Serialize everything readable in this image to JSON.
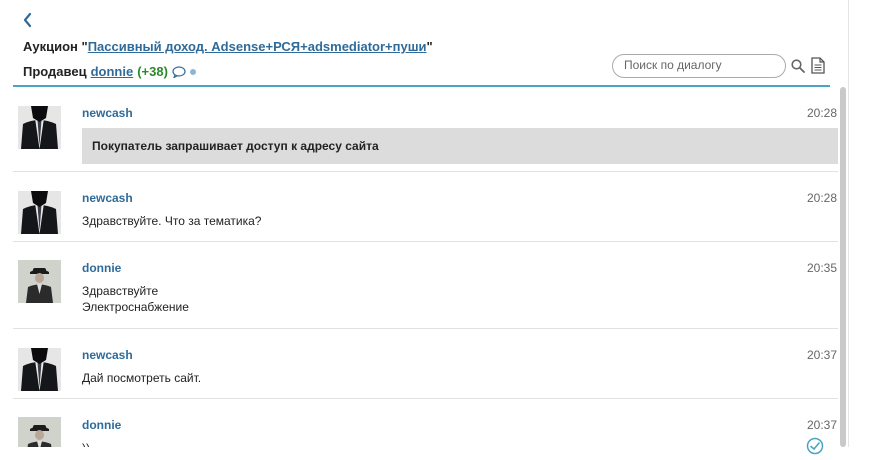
{
  "header": {
    "auction_prefix": "Аукцион \"",
    "auction_link": "Пассивный доход. Adsense+РСЯ+adsmediator+пуши",
    "auction_suffix": "\"",
    "seller_label": "Продавец",
    "seller_name": "donnie",
    "seller_rating": "(+38)"
  },
  "search": {
    "placeholder": "Поиск по диалогу"
  },
  "icons": {
    "back": "chevron-left-icon",
    "chat": "speech-bubble-icon",
    "search": "search-icon",
    "document": "document-icon",
    "check": "checkmark-icon"
  },
  "colors": {
    "accent": "#2f6b9a",
    "divider": "#4aa3c6",
    "rating": "#2a8a2a",
    "system_box": "#dcdcdc"
  },
  "messages": [
    {
      "author": "newcash",
      "time": "20:28",
      "system_text": "Покупатель запрашивает доступ к адресу сайта"
    },
    {
      "author": "newcash",
      "time": "20:28",
      "lines": [
        "Здравствуйте. Что за тематика?"
      ]
    },
    {
      "author": "donnie",
      "time": "20:35",
      "lines": [
        "Здравствуйте",
        "Электроснабжение"
      ]
    },
    {
      "author": "newcash",
      "time": "20:37",
      "lines": [
        "Дай посмотреть сайт."
      ]
    },
    {
      "author": "donnie",
      "time": "20:37",
      "lines": [
        "))"
      ]
    }
  ]
}
